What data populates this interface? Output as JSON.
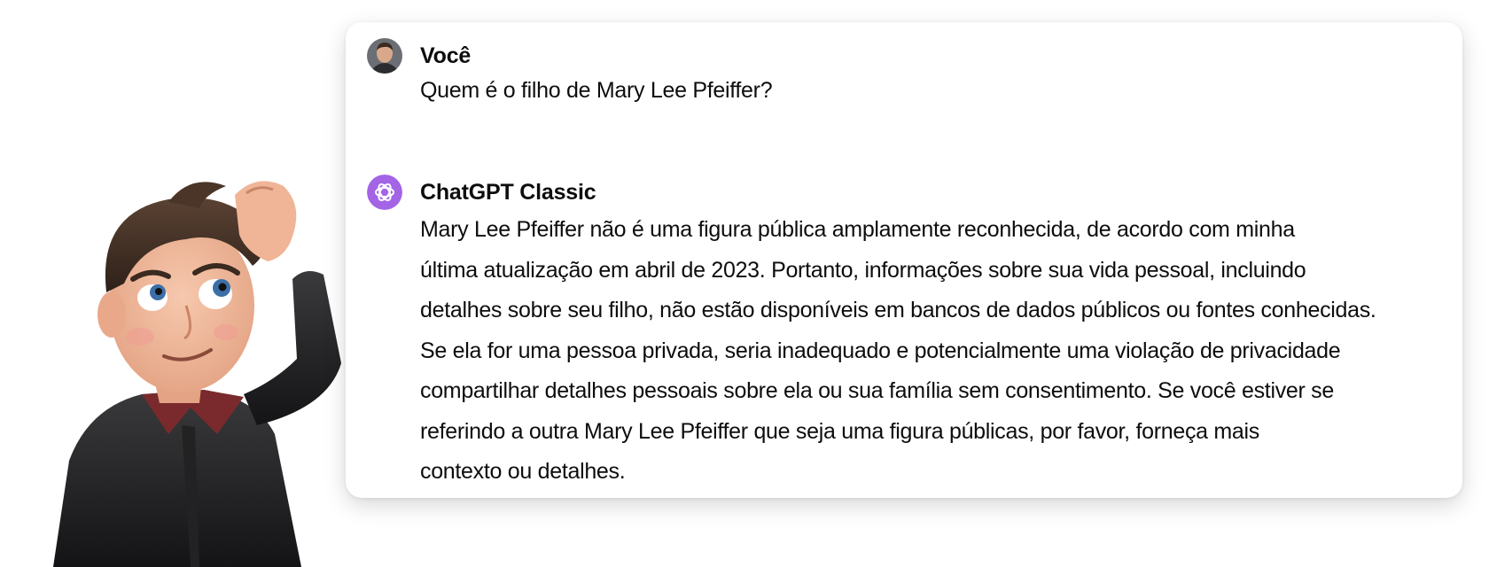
{
  "colors": {
    "assistant_avatar_bg": "#a464e6",
    "card_bg": "#ffffff",
    "text": "#0d0d0d"
  },
  "character": {
    "icon": "confused-cartoon-man-scratching-head"
  },
  "conversation": {
    "user": {
      "author": "Você",
      "avatar_icon": "user-photo-avatar",
      "message": "Quem é o filho de Mary Lee Pfeiffer?"
    },
    "assistant": {
      "author": "ChatGPT Classic",
      "avatar_icon": "openai-logo-icon",
      "lines": [
        "Mary Lee Pfeiffer não é uma figura pública amplamente reconhecida, de acordo com minha",
        "última atualização em abril de 2023. Portanto, informações sobre sua vida pessoal, incluindo",
        "detalhes sobre seu filho, não estão disponíveis em bancos de dados públicos ou fontes conhecidas.",
        "Se ela for uma pessoa privada, seria inadequado e potencialmente uma violação de privacidade",
        "compartilhar detalhes pessoais sobre ela ou sua família sem consentimento. Se você estiver se",
        "referindo a outra Mary Lee Pfeiffer que seja uma figura públicas, por favor, forneça mais",
        "contexto ou detalhes."
      ]
    }
  }
}
